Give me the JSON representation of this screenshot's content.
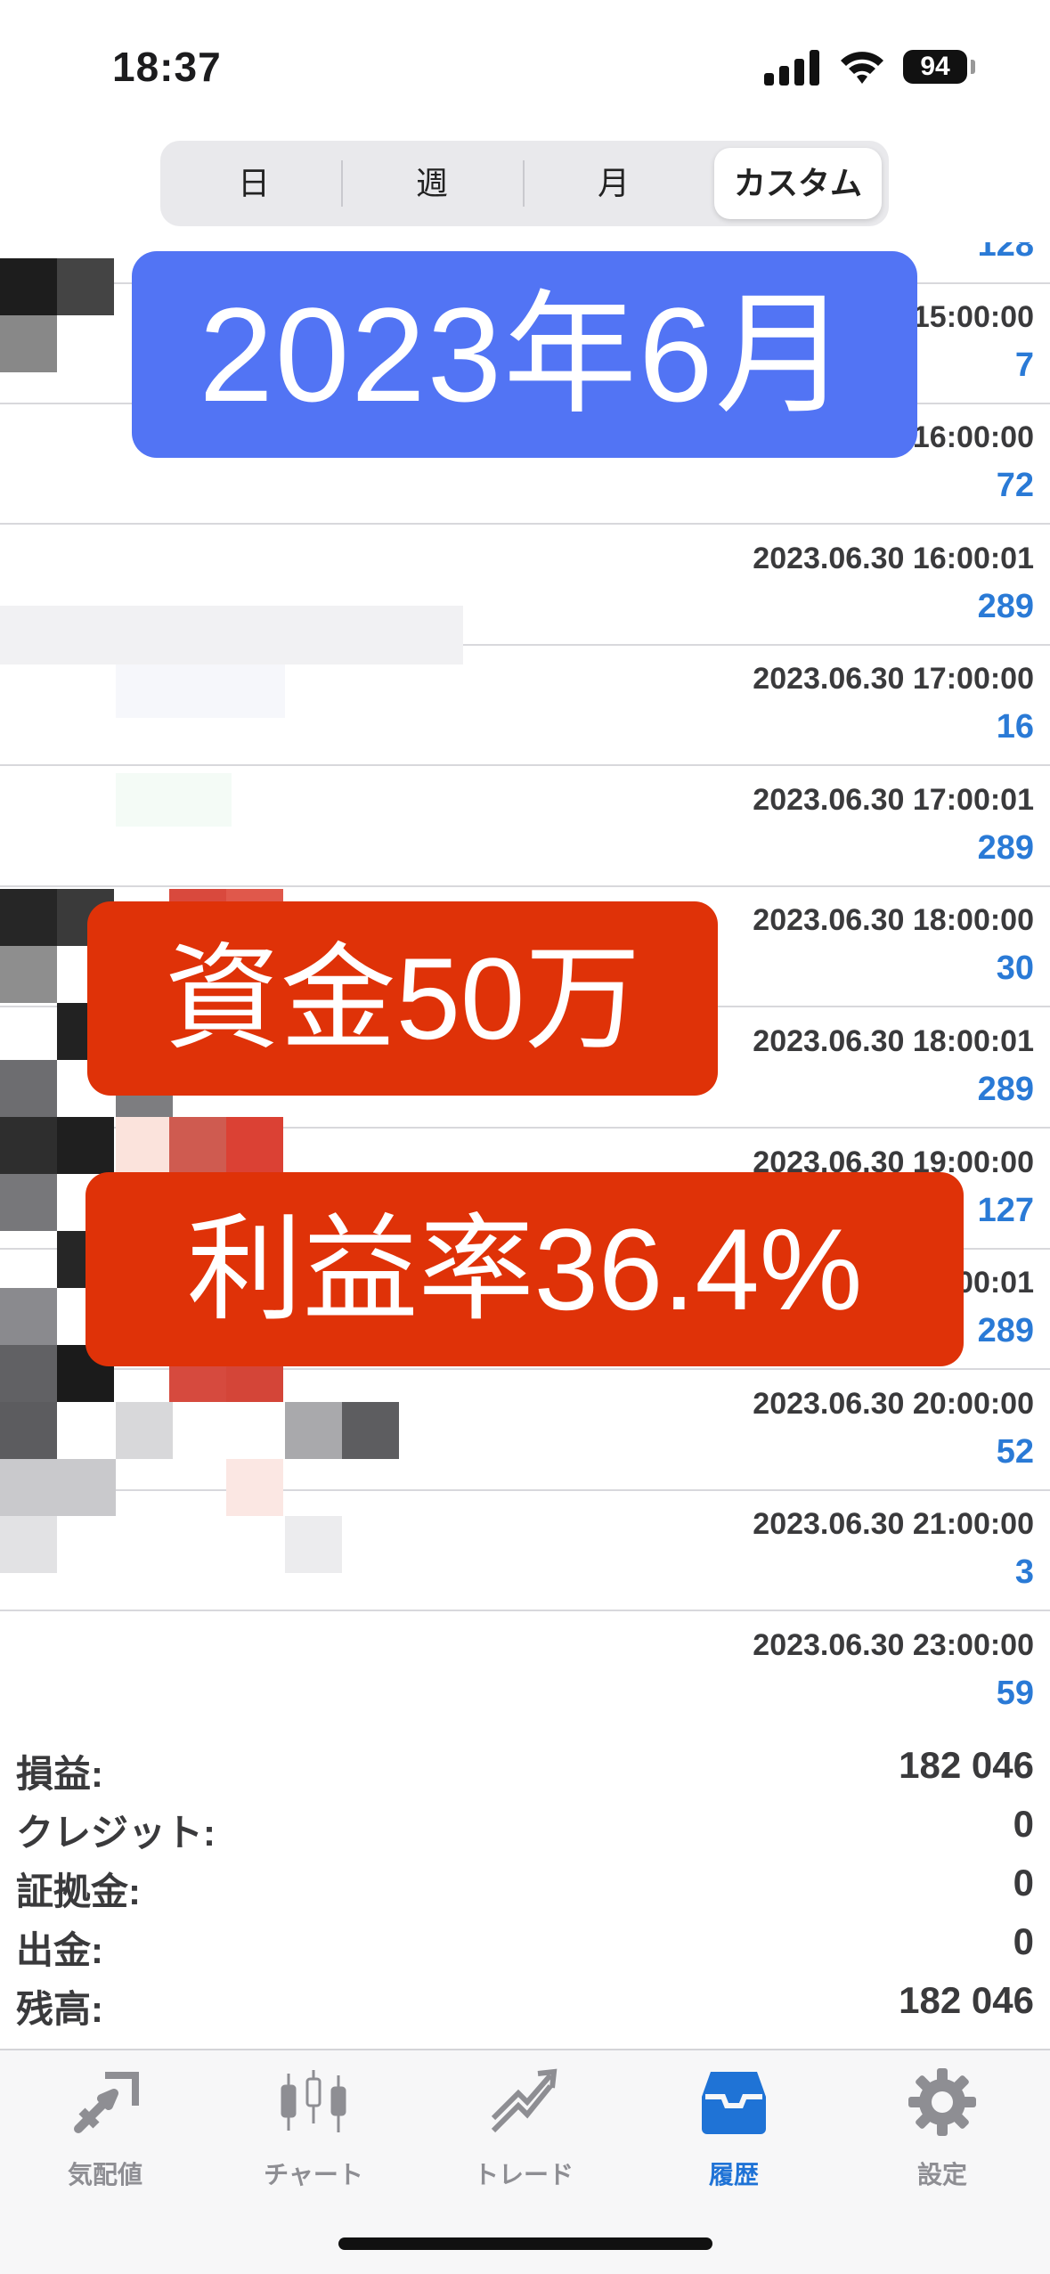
{
  "status_bar": {
    "time": "18:37",
    "battery": "94"
  },
  "segments": [
    {
      "label": "日"
    },
    {
      "label": "週"
    },
    {
      "label": "月"
    },
    {
      "label": "カスタム",
      "active": true
    }
  ],
  "rows": [
    {
      "time": "",
      "value": "128"
    },
    {
      "time": "15:00:00",
      "value": "7"
    },
    {
      "time": "16:00:00",
      "value": "72"
    },
    {
      "time": "2023.06.30 16:00:01",
      "value": "289"
    },
    {
      "time": "2023.06.30 17:00:00",
      "value": "16"
    },
    {
      "time": "2023.06.30 17:00:01",
      "value": "289"
    },
    {
      "time": "2023.06.30 18:00:00",
      "value": "30"
    },
    {
      "time": "2023.06.30 18:00:01",
      "value": "289"
    },
    {
      "time": "2023.06.30 19:00:00",
      "value": "127"
    },
    {
      "time": "00:01",
      "value": "289"
    },
    {
      "time": "2023.06.30 20:00:00",
      "value": "52"
    },
    {
      "time": "2023.06.30 21:00:00",
      "value": "3"
    },
    {
      "time": "2023.06.30 23:00:00",
      "value": "59"
    }
  ],
  "overlays": {
    "date": "2023年6月",
    "capital": "資金50万",
    "profit_rate": "利益率36.4%"
  },
  "summary": [
    {
      "label": "損益:",
      "value": "182 046"
    },
    {
      "label": "クレジット:",
      "value": "0"
    },
    {
      "label": "証拠金:",
      "value": "0"
    },
    {
      "label": "出金:",
      "value": "0"
    },
    {
      "label": "残高:",
      "value": "182 046"
    }
  ],
  "tabs": [
    {
      "label": "気配値",
      "icon": "quotes-icon"
    },
    {
      "label": "チャート",
      "icon": "candlestick-chart-icon"
    },
    {
      "label": "トレード",
      "icon": "trade-icon"
    },
    {
      "label": "履歴",
      "icon": "history-inbox-icon",
      "active": true
    },
    {
      "label": "設定",
      "icon": "gear-icon"
    }
  ],
  "colors": {
    "value_blue": "#2a7ad6",
    "banner_blue": "#5274f4",
    "banner_red": "#df3208",
    "tab_active": "#1f73d6",
    "tab_inactive": "#8e8e93"
  }
}
